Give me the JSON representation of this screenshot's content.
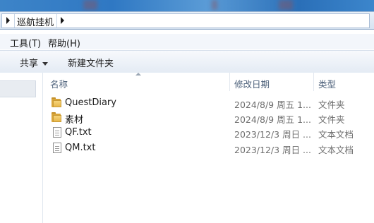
{
  "address": {
    "crumbs": [
      {
        "label": "巡航挂机"
      }
    ]
  },
  "menu": {
    "items": [
      {
        "label": "工具(T)"
      },
      {
        "label": "帮助(H)"
      }
    ]
  },
  "toolbar": {
    "share_label": "共享",
    "new_folder_label": "新建文件夹"
  },
  "columns": {
    "name": "名称",
    "date": "修改日期",
    "type": "类型"
  },
  "files": [
    {
      "name": "QuestDiary",
      "date": "2024/8/9 周五 1...",
      "type": "文件夹",
      "icon": "folder-icon"
    },
    {
      "name": "素材",
      "date": "2024/8/9 周五 1...",
      "type": "文件夹",
      "icon": "folder-icon"
    },
    {
      "name": "QF.txt",
      "date": "2023/12/3 周日 ...",
      "type": "文本文档",
      "icon": "text-file-icon"
    },
    {
      "name": "QM.txt",
      "date": "2023/12/3 周日 ...",
      "type": "文本文档",
      "icon": "text-file-icon"
    }
  ]
}
